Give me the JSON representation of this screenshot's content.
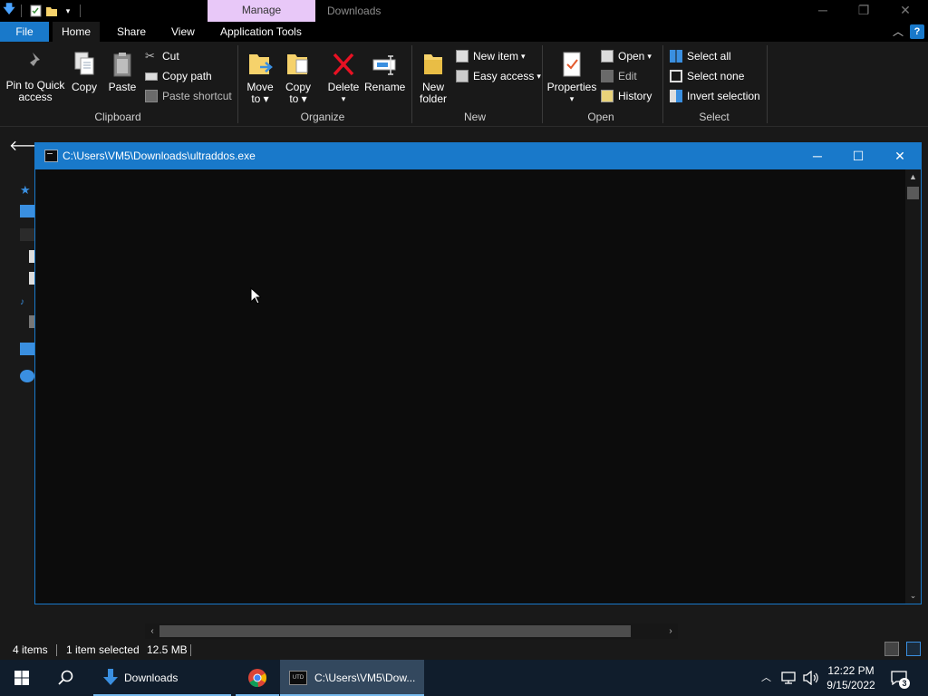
{
  "explorer": {
    "title": "Downloads",
    "contextual_tab": "Manage",
    "tabs": [
      "File",
      "Home",
      "Share",
      "View",
      "Application Tools"
    ],
    "window_controls": {
      "minimize": "─",
      "restore": "❐",
      "close": "✕"
    },
    "ribbon": {
      "clipboard": {
        "label": "Clipboard",
        "pin": "Pin to Quick access",
        "pin_line1": "Pin to Quick",
        "pin_line2": "access",
        "copy": "Copy",
        "paste": "Paste",
        "cut": "Cut",
        "copy_path": "Copy path",
        "paste_shortcut": "Paste shortcut"
      },
      "organize": {
        "label": "Organize",
        "move_to_1": "Move",
        "move_to_2": "to",
        "copy_to_1": "Copy",
        "copy_to_2": "to",
        "delete": "Delete",
        "rename": "Rename"
      },
      "new": {
        "label": "New",
        "new_folder_1": "New",
        "new_folder_2": "folder",
        "new_item": "New item",
        "easy_access": "Easy access"
      },
      "open": {
        "label": "Open",
        "properties": "Properties",
        "open": "Open",
        "edit": "Edit",
        "history": "History"
      },
      "select": {
        "label": "Select",
        "select_all": "Select all",
        "select_none": "Select none",
        "invert_selection": "Invert selection"
      }
    },
    "status": {
      "items": "4 items",
      "selected": "1 item selected",
      "size": "12.5 MB"
    }
  },
  "console": {
    "title": "C:\\Users\\VM5\\Downloads\\ultraddos.exe",
    "controls": {
      "minimize": "─",
      "maximize": "☐",
      "close": "✕"
    }
  },
  "taskbar": {
    "items": [
      {
        "label": "Downloads"
      },
      {
        "label": ""
      },
      {
        "label": "C:\\Users\\VM5\\Dow..."
      }
    ],
    "clock": {
      "time": "12:22 PM",
      "date": "9/15/2022"
    },
    "notification_count": "3"
  },
  "colors": {
    "accent": "#1979ca",
    "manage_tab": "#e8c8f8",
    "explorer_bg": "#191919",
    "console_bg": "#0c0c0c",
    "taskbar_bg": "#101d2c"
  }
}
